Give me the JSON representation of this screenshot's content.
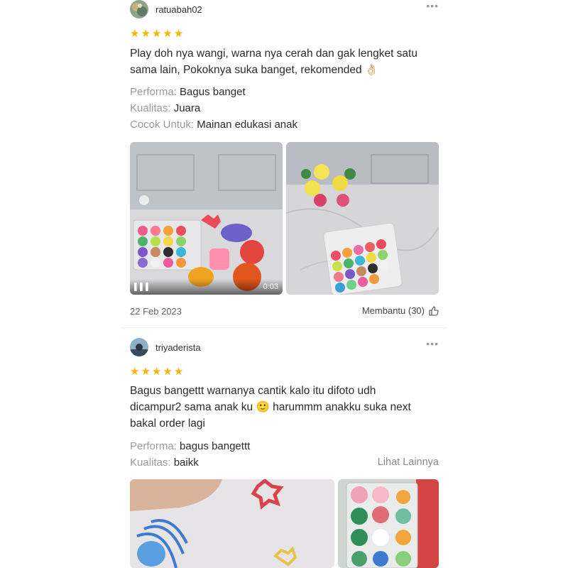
{
  "reviews": [
    {
      "username": "ratuabah02",
      "more_icon": "more-dots-icon",
      "rating": 5,
      "text_line1": "Play doh nya wangi, warna nya cerah dan gak lengket satu",
      "text_line2": "sama lain, Pokoknya suka banget, rekomended 👌🏻",
      "attributes": [
        {
          "key": "Performa:",
          "value": "Bagus banget"
        },
        {
          "key": "Kualitas:",
          "value": "Juara"
        },
        {
          "key": "Cocok Untuk:",
          "value": "Mainan edukasi anak"
        }
      ],
      "video_duration": "0:03",
      "date": "22 Feb 2023",
      "helpful_label": "Membantu (30)"
    },
    {
      "username": "triyaderista",
      "more_icon": "more-dots-icon",
      "rating": 5,
      "text_line1": "Bagus bangettt warnanya cantik kalo itu difoto udh",
      "text_line2": "dicampur2 sama anak ku 🙂  harummm anakku suka next",
      "text_line3": "bakal order lagi",
      "attributes": [
        {
          "key": "Performa:",
          "value": "bagus bangettt"
        },
        {
          "key": "Kualitas:",
          "value": "baikk"
        }
      ],
      "see_more": "Lihat Lainnya"
    }
  ],
  "colors": {
    "star": "#f7b500",
    "attr_key": "#9a9a9a",
    "divider": "#eeeeee"
  }
}
